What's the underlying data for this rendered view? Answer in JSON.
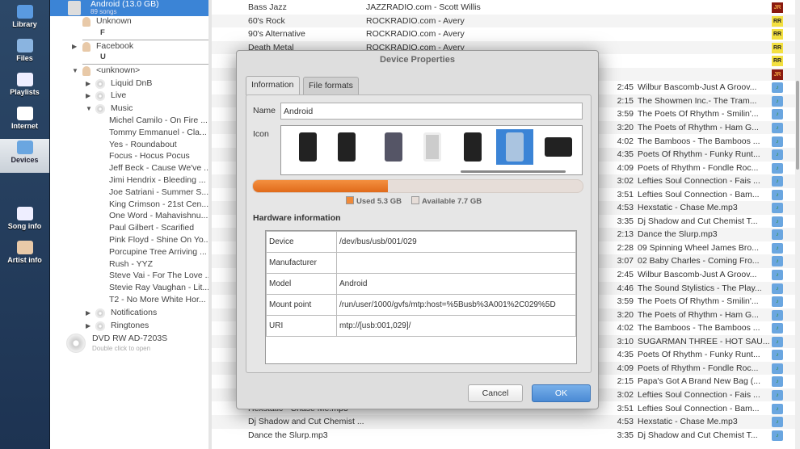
{
  "nav": [
    {
      "label": "Library"
    },
    {
      "label": "Files"
    },
    {
      "label": "Playlists"
    },
    {
      "label": "Internet"
    },
    {
      "label": "Devices",
      "selected": true
    },
    {
      "label": "Song info"
    },
    {
      "label": "Artist info"
    }
  ],
  "tree": {
    "device": {
      "name": "Android (13.0 GB)",
      "songs": "89 songs"
    },
    "artists": [
      {
        "name": "Unknown",
        "letter": "F"
      },
      {
        "name": "Facebook",
        "letter": "U"
      }
    ],
    "unknown": "<unknown>",
    "folders": [
      "Liquid DnB",
      "Live",
      "Music"
    ],
    "music": [
      "Michel Camilo - On Fire ...",
      "Tommy Emmanuel - Cla...",
      "Yes - Roundabout",
      "Focus - Hocus Pocus",
      "Jeff Beck - Cause We've ...",
      "Jimi Hendrix - Bleeding ...",
      "Joe Satriani - Summer S...",
      "King Crimson - 21st Cen...",
      "One Word - Mahavishnu...",
      "Paul Gilbert - Scarified",
      "Pink Floyd - Shine On Yo...",
      "Porcupine Tree Arriving ...",
      "Rush - YYZ",
      "Steve Vai - For The Love ...",
      "Stevie Ray Vaughan - Lit...",
      "T2 - No More White Hor..."
    ],
    "folders2": [
      "Notifications",
      "Ringtones"
    ],
    "dvd": {
      "name": "DVD RW AD-7203S",
      "hint": "Double click to open"
    }
  },
  "playlist": {
    "rows": [
      {
        "title": "Bass Jazz",
        "artist": "JAZZRADIO.com - Scott Willis",
        "length": "",
        "file": "",
        "badge": "JR"
      },
      {
        "title": "60's Rock",
        "artist": "ROCKRADIO.com - Avery",
        "length": "",
        "file": "",
        "badge": "RR"
      },
      {
        "title": "90's Alternative",
        "artist": "ROCKRADIO.com - Avery",
        "length": "",
        "file": "",
        "badge": "RR"
      },
      {
        "title": "Death Metal",
        "artist": "ROCKRADIO.com - Avery",
        "length": "",
        "file": "",
        "badge": "RR"
      },
      {
        "title": "",
        "artist": "",
        "length": "",
        "file": "",
        "badge": "RR"
      },
      {
        "title": "",
        "artist": "",
        "length": "",
        "file": "",
        "badge": "JR"
      },
      {
        "title": "",
        "artist": "",
        "length": "2:45",
        "file": "Wilbur Bascomb-Just A Groov...",
        "badge": "note"
      },
      {
        "title": "",
        "artist": "",
        "length": "2:15",
        "file": "The Showmen Inc.- The Tram...",
        "badge": "note"
      },
      {
        "title": "",
        "artist": "",
        "length": "3:59",
        "file": "The Poets Of Rhythm - Smilin'...",
        "badge": "note"
      },
      {
        "title": "",
        "artist": "",
        "length": "3:20",
        "file": "The Poets of Rhythm - Ham G...",
        "badge": "note"
      },
      {
        "title": "",
        "artist": "",
        "length": "4:02",
        "file": "The Bamboos - The Bamboos ...",
        "badge": "note"
      },
      {
        "title": "",
        "artist": "",
        "length": "4:35",
        "file": "Poets Of Rhythm - Funky Runt...",
        "badge": "note"
      },
      {
        "title": "",
        "artist": "",
        "length": "4:09",
        "file": "Poets of Rhythm - Fondle Roc...",
        "badge": "note"
      },
      {
        "title": "",
        "artist": "",
        "length": "3:02",
        "file": "Lefties Soul Connection - Fais ...",
        "badge": "note"
      },
      {
        "title": "",
        "artist": "",
        "length": "3:51",
        "file": "Lefties Soul Connection - Bam...",
        "badge": "note"
      },
      {
        "title": "",
        "artist": "",
        "length": "4:53",
        "file": "Hexstatic - Chase Me.mp3",
        "badge": "note"
      },
      {
        "title": "",
        "artist": "",
        "length": "3:35",
        "file": "Dj Shadow and Cut Chemist T...",
        "badge": "note"
      },
      {
        "title": "",
        "artist": "",
        "length": "2:13",
        "file": "Dance the Slurp.mp3",
        "badge": "note"
      },
      {
        "title": "",
        "artist": "",
        "length": "2:28",
        "file": "09 Spinning Wheel James Bro...",
        "badge": "note"
      },
      {
        "title": "",
        "artist": "",
        "length": "3:07",
        "file": "02 Baby Charles - Coming Fro...",
        "badge": "note"
      },
      {
        "title": "",
        "artist": "",
        "length": "2:45",
        "file": "Wilbur Bascomb-Just A Groov...",
        "badge": "note"
      },
      {
        "title": "",
        "artist": "",
        "length": "4:46",
        "file": "The Sound Stylistics - The Play...",
        "badge": "note"
      },
      {
        "title": "",
        "artist": "",
        "length": "3:59",
        "file": "The Poets Of Rhythm - Smilin'...",
        "badge": "note"
      },
      {
        "title": "",
        "artist": "",
        "length": "3:20",
        "file": "The Poets of Rhythm - Ham G...",
        "badge": "note"
      },
      {
        "title": "",
        "artist": "",
        "length": "4:02",
        "file": "The Bamboos - The Bamboos ...",
        "badge": "note"
      },
      {
        "title": "",
        "artist": "",
        "length": "3:10",
        "file": "SUGARMAN THREE - HOT SAU...",
        "badge": "note"
      },
      {
        "title": "",
        "artist": "",
        "length": "4:35",
        "file": "Poets Of Rhythm - Funky Runt...",
        "badge": "note"
      },
      {
        "title": "",
        "artist": "",
        "length": "4:09",
        "file": "Poets of Rhythm - Fondle Roc...",
        "badge": "note"
      },
      {
        "title": "",
        "artist": "",
        "length": "2:15",
        "file": "Papa's Got A Brand New Bag (...",
        "badge": "note"
      },
      {
        "title": "Lefties Soul Connection - Bam...",
        "artist": "",
        "length": "3:02",
        "file": "Lefties Soul Connection - Fais ...",
        "badge": "note"
      },
      {
        "title": "Hexstatic - Chase Me.mp3",
        "artist": "",
        "length": "3:51",
        "file": "Lefties Soul Connection - Bam...",
        "badge": "note"
      },
      {
        "title": "Dj Shadow and Cut Chemist ...",
        "artist": "",
        "length": "4:53",
        "file": "Hexstatic - Chase Me.mp3",
        "badge": "note"
      },
      {
        "title": "Dance the Slurp.mp3",
        "artist": "",
        "length": "3:35",
        "file": "Dj Shadow and Cut Chemist T...",
        "badge": "note"
      }
    ]
  },
  "dialog": {
    "title": "Device Properties",
    "tabs": [
      "Information",
      "File formats"
    ],
    "name_label": "Name",
    "name_value": "Android",
    "icon_label": "Icon",
    "storage": {
      "used_fraction": 0.41,
      "used": "Used 5.3 GB",
      "available": "Available 7.7 GB",
      "used_color": "#e8782a"
    },
    "hw_title": "Hardware information",
    "hw": [
      [
        "Device",
        "/dev/bus/usb/001/029"
      ],
      [
        "Manufacturer",
        ""
      ],
      [
        "Model",
        "Android"
      ],
      [
        "Mount point",
        "/run/user/1000/gvfs/mtp:host=%5Busb%3A001%2C029%5D"
      ],
      [
        "URI",
        "mtp://[usb:001,029]/"
      ]
    ],
    "cancel": "Cancel",
    "ok": "OK"
  }
}
